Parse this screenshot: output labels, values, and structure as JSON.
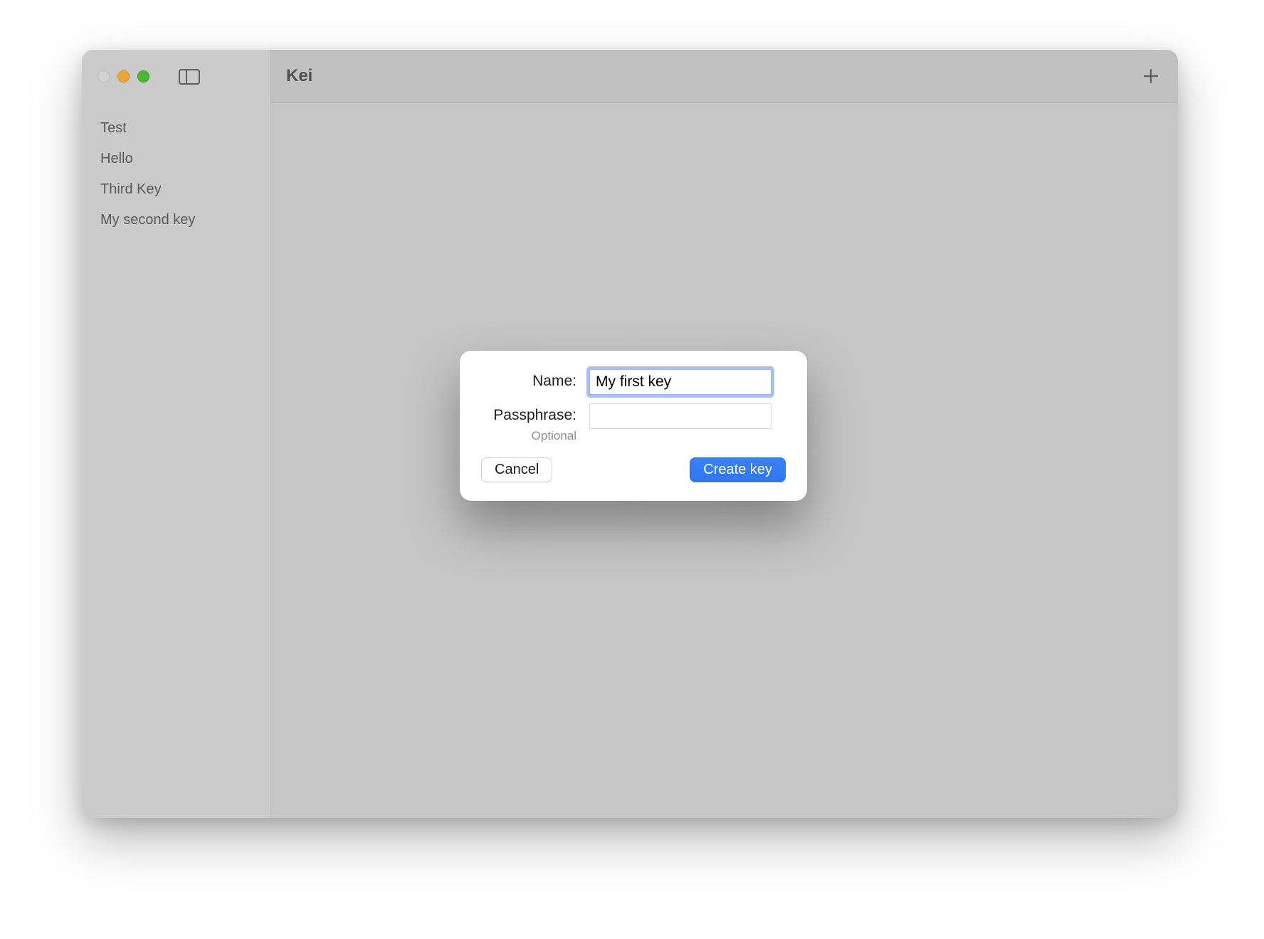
{
  "window": {
    "title": "Kei"
  },
  "sidebar": {
    "items": [
      {
        "label": "Test"
      },
      {
        "label": "Hello"
      },
      {
        "label": "Third Key"
      },
      {
        "label": "My second key"
      }
    ]
  },
  "dialog": {
    "name_label": "Name:",
    "name_value": "My first key",
    "passphrase_label": "Passphrase:",
    "passphrase_hint": "Optional",
    "passphrase_value": "",
    "cancel_label": "Cancel",
    "create_label": "Create key"
  }
}
